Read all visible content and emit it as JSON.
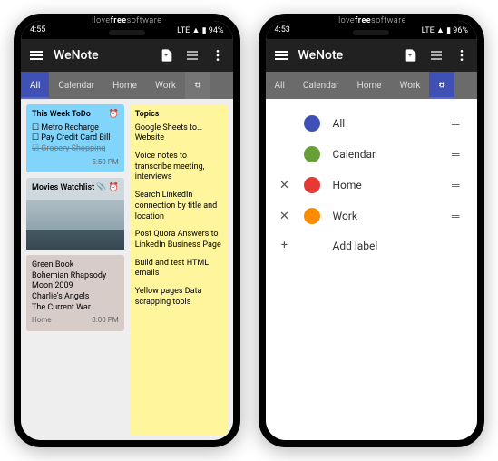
{
  "watermark_pre": "ilove",
  "watermark_mid": "free",
  "watermark_post": "software",
  "left": {
    "time": "4:55",
    "status": "LTE ▲ ▮ 94%",
    "title": "WeNote",
    "tabs": [
      "All",
      "Calendar",
      "Home",
      "Work"
    ],
    "active_tab": 0,
    "note1": {
      "title": "This Week ToDo",
      "items": [
        "☐ Metro Recharge",
        "☐ Pay Credit Card Bill"
      ],
      "done": "☑ Grocery Shopping",
      "time": "5:50 PM"
    },
    "note2": {
      "title": "Movies Watchlist",
      "body": "Green Book\nBohemian Rhapsody\nMoon 2009\nCharlie's Angels\nThe Current War",
      "cat": "Home",
      "time": "8:00 PM"
    },
    "note3": {
      "title": "Topics",
      "items": [
        "Google Sheets to… Website",
        "Voice notes to transcribe meeting, interviews",
        "Search LinkedIn connection by title and location",
        "Post Quora Answers to LinkedIn Business Page",
        "Build and test HTML emails",
        "Yellow pages Data scrapping tools"
      ]
    }
  },
  "right": {
    "time": "4:53",
    "status": "LTE ▲ ▮ 96%",
    "title": "WeNote",
    "tabs": [
      "All",
      "Calendar",
      "Home",
      "Work"
    ],
    "active_tab": 4,
    "labels": [
      {
        "x": "",
        "color": "#3f51b5",
        "name": "All"
      },
      {
        "x": "",
        "color": "#689f38",
        "name": "Calendar"
      },
      {
        "x": "✕",
        "color": "#e53935",
        "name": "Home"
      },
      {
        "x": "✕",
        "color": "#fb8c00",
        "name": "Work"
      }
    ],
    "add_label": "Add label"
  }
}
